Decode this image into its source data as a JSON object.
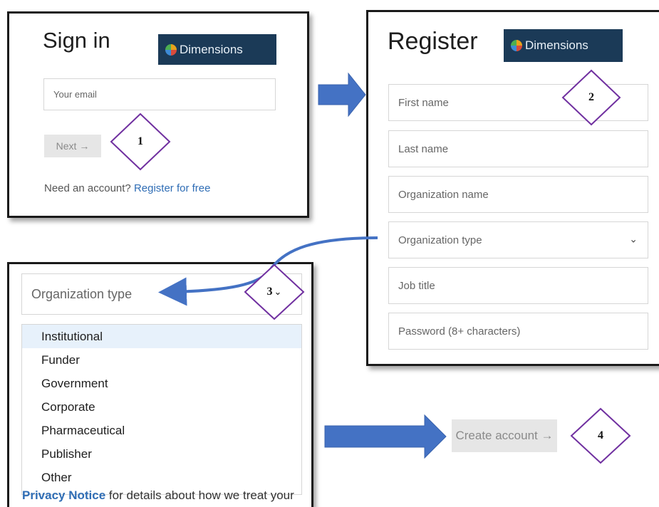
{
  "signin": {
    "title": "Sign in",
    "logo_text": "Dimensions",
    "email_placeholder": "Your email",
    "next_label": "Next →",
    "need_account": "Need an account?",
    "register_link": "Register for free"
  },
  "register": {
    "title": "Register",
    "logo_text": "Dimensions",
    "fields": [
      {
        "label": "First name"
      },
      {
        "label": "Last name"
      },
      {
        "label": "Organization name"
      },
      {
        "label": "Organization type"
      },
      {
        "label": "Job title"
      },
      {
        "label": "Password (8+ characters)"
      }
    ]
  },
  "orgtype": {
    "placeholder": "Organization type",
    "options": [
      "Institutional",
      "Funder",
      "Government",
      "Corporate",
      "Pharmaceutical",
      "Publisher",
      "Other"
    ],
    "selected": "Institutional",
    "privacy_link": "Privacy Notice",
    "privacy_text": "for details about how we treat your"
  },
  "create_account_label": "Create account →",
  "steps": [
    "1",
    "2",
    "3",
    "4"
  ],
  "colors": {
    "arrow_blue": "#4472c4",
    "diamond_purple": "#7030a0",
    "logo_bg": "#1b3a57",
    "link_blue": "#2f6db5",
    "selected_bg": "#e7f1fb"
  }
}
